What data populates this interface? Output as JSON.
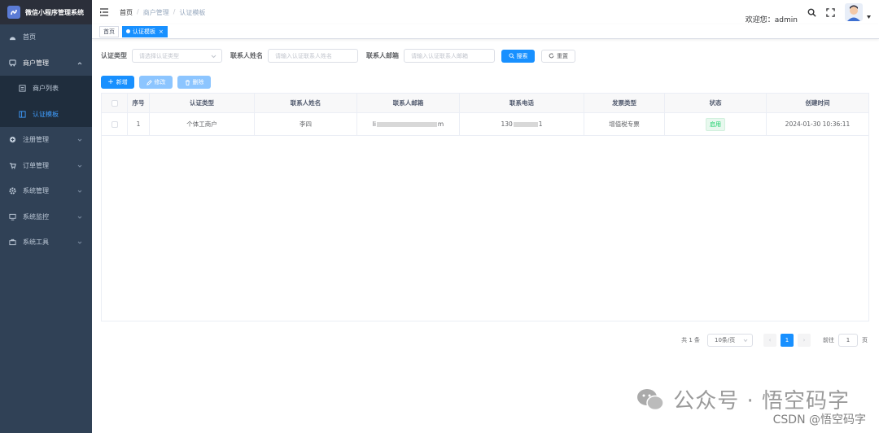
{
  "app": {
    "title": "微信小程序管理系统"
  },
  "sidebar": {
    "items": [
      {
        "label": "首页",
        "icon": "dashboard-icon"
      },
      {
        "label": "商户管理",
        "icon": "bus-icon"
      },
      {
        "label": "商户列表",
        "icon": "list-icon"
      },
      {
        "label": "认证模板",
        "icon": "template-icon"
      },
      {
        "label": "注册管理",
        "icon": "circle-plus-icon"
      },
      {
        "label": "订单管理",
        "icon": "cart-icon"
      },
      {
        "label": "系统管理",
        "icon": "gear-icon"
      },
      {
        "label": "系统监控",
        "icon": "monitor-icon"
      },
      {
        "label": "系统工具",
        "icon": "toolbox-icon"
      }
    ]
  },
  "breadcrumb": {
    "home": "首页",
    "sep": "/",
    "level1": "商户管理",
    "level2": "认证模板"
  },
  "navbar": {
    "welcome": "欢迎您：admin"
  },
  "tags": {
    "home": "首页",
    "active": "认证模板",
    "close": "×"
  },
  "search": {
    "type_label": "认证类型",
    "type_placeholder": "请选择认证类型",
    "name_label": "联系人姓名",
    "name_placeholder": "请输入认证联系人姓名",
    "email_label": "联系人邮箱",
    "email_placeholder": "请输入认证联系人邮箱",
    "search_btn": "搜索",
    "reset_btn": "重置"
  },
  "toolbar": {
    "add": "新增",
    "edit": "修改",
    "delete": "删除"
  },
  "table": {
    "columns": [
      "序号",
      "认证类型",
      "联系人姓名",
      "联系人邮箱",
      "联系电话",
      "发票类型",
      "状态",
      "创建时间"
    ],
    "rows": [
      {
        "index": "1",
        "type": "个体工商户",
        "name": "李四",
        "email_prefix": "li",
        "email_suffix": "m",
        "phone_prefix": "130",
        "phone_suffix": "1",
        "invoice": "增值税专票",
        "status": "启用",
        "created": "2024-01-30 10:36:11"
      }
    ]
  },
  "pagination": {
    "total": "共 1 条",
    "page_size": "10条/页",
    "current": "1",
    "goto_label": "前往",
    "goto_value": "1",
    "page_unit": "页"
  },
  "watermark": {
    "text": "公众号 · 悟空码字",
    "csdn": "CSDN @悟空码字"
  },
  "colors": {
    "sidebar_bg": "#304156",
    "primary": "#1890ff",
    "active_menu": "#409eff",
    "success": "#13ce66"
  }
}
